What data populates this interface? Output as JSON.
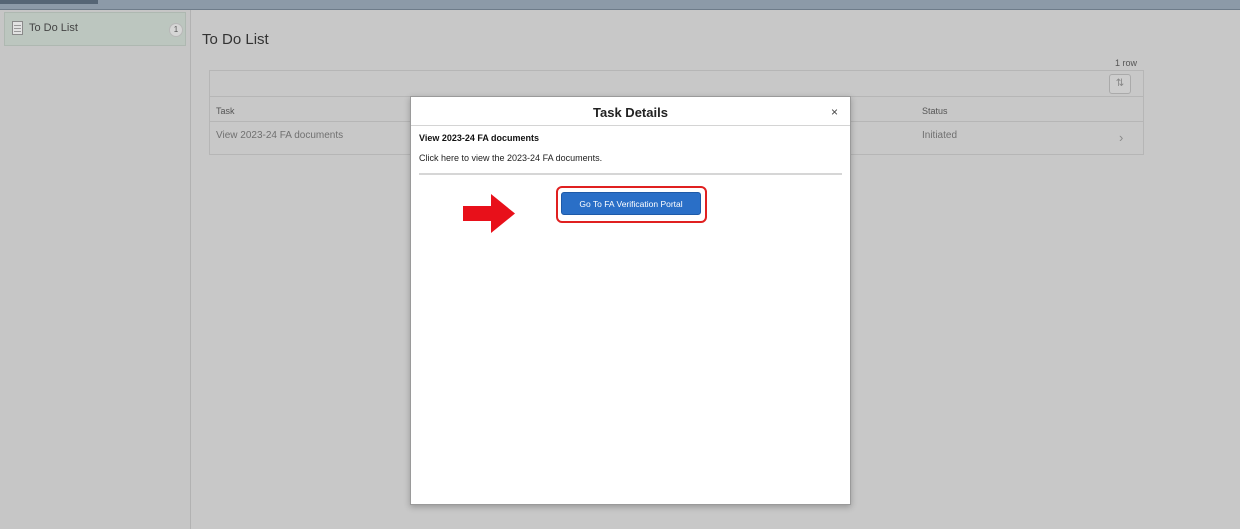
{
  "sidebar": {
    "items": [
      {
        "label": "To Do List",
        "count": "1",
        "icon": "list-icon"
      }
    ]
  },
  "page": {
    "title": "To Do List",
    "row_count": "1 row",
    "sort_icon": "sort-icon"
  },
  "table": {
    "columns": [
      "Task",
      "Status"
    ],
    "rows": [
      {
        "task": "View 2023-24 FA documents",
        "status": "Initiated"
      }
    ]
  },
  "modal": {
    "title": "Task Details",
    "close_glyph": "×",
    "task_heading": "View 2023-24 FA documents",
    "task_description": "Click here to view the 2023-24 FA documents.",
    "button_label": "Go To FA Verification Portal"
  },
  "annotations": {
    "arrow_color": "#e8101a",
    "highlight_color": "#e02020"
  },
  "colors": {
    "button": "#2a6fc7",
    "overlay": "#c8c8c8"
  }
}
